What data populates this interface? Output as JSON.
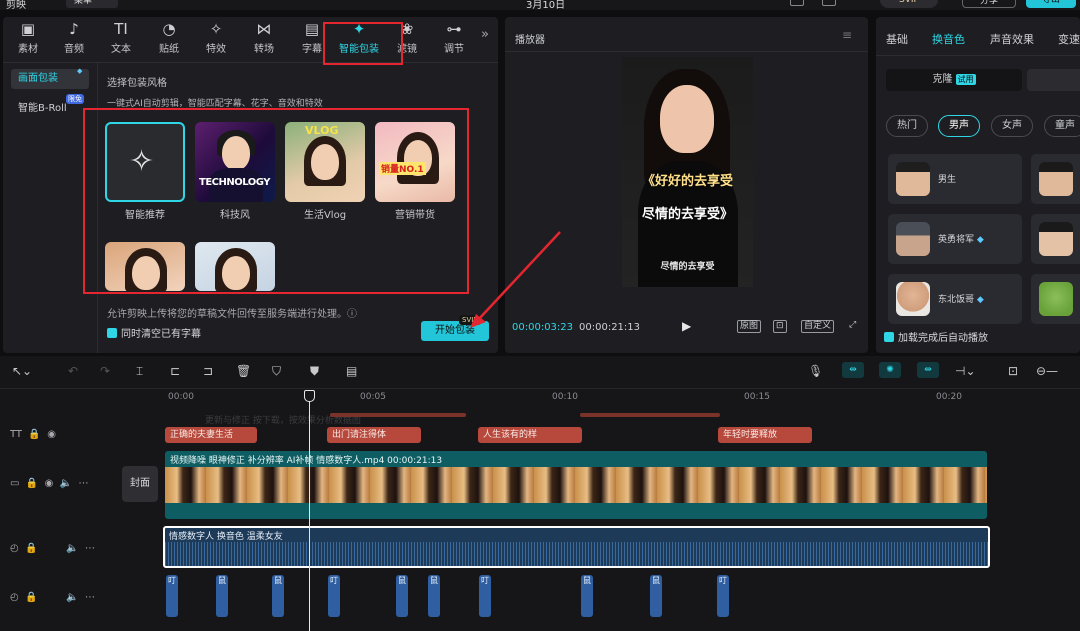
{
  "topbar": {
    "app_name": "剪映",
    "menu_label": "菜单",
    "date": "3月10日",
    "svip_label": "SVIP",
    "share_label": "分享",
    "export_label": "导出"
  },
  "toolbar": {
    "tools": [
      {
        "icon": "media-icon",
        "glyph": "▣",
        "label": "素材"
      },
      {
        "icon": "audio-icon",
        "glyph": "♪",
        "label": "音频"
      },
      {
        "icon": "text-icon",
        "glyph": "TI",
        "label": "文本"
      },
      {
        "icon": "sticker-icon",
        "glyph": "◔",
        "label": "贴纸"
      },
      {
        "icon": "effects-icon",
        "glyph": "✧",
        "label": "特效"
      },
      {
        "icon": "transition-icon",
        "glyph": "⋈",
        "label": "转场"
      },
      {
        "icon": "caption-icon",
        "glyph": "▤",
        "label": "字幕"
      },
      {
        "icon": "smart-pack-icon",
        "glyph": "✦",
        "label": "智能包装"
      },
      {
        "icon": "filter-icon",
        "glyph": "❀",
        "label": "滤镜"
      },
      {
        "icon": "adjust-icon",
        "glyph": "⊶",
        "label": "调节"
      }
    ],
    "more_glyph": "»"
  },
  "left_panel": {
    "side_items": [
      {
        "label": "画面包装",
        "badge": "◆"
      },
      {
        "label": "智能B-Roll",
        "badge": "限免"
      }
    ],
    "style_title": "选择包装风格",
    "style_desc": "一键式AI自动剪辑，智能匹配字幕、花字、音效和特效",
    "cards": [
      {
        "label": "智能推荐"
      },
      {
        "label": "科技风",
        "overlay": "TECHNOLOGY"
      },
      {
        "label": "生活Vlog",
        "overlay": "VLOG"
      },
      {
        "label": "营销带货",
        "overlay": "销量NO.1"
      },
      {
        "label": ""
      },
      {
        "label": ""
      }
    ],
    "upload_note": "允许剪映上传将您的草稿文件回传至服务端进行处理。ⓘ",
    "clear_subtitles": "同时清空已有字幕",
    "start_button": "开始包装",
    "svip_tag": "SVIP"
  },
  "player": {
    "title": "播放器",
    "captions": [
      "《好好的去享受",
      "尽情的去享受》",
      "尽情的去享受"
    ],
    "current_time": "00:00:03:23",
    "total_time": "00:00:21:13",
    "controls": [
      "原图",
      "⊡",
      "自定义",
      "⤢"
    ]
  },
  "right_panel": {
    "tabs": [
      "基础",
      "换音色",
      "声音效果",
      "变速"
    ],
    "clone_label": "克隆",
    "trial_tag": "试用",
    "chips": [
      "热门",
      "男声",
      "女声",
      "童声"
    ],
    "voices": [
      {
        "name": "男生",
        "diamond": ""
      },
      {
        "name": "英勇将军",
        "diamond": "◆"
      },
      {
        "name": "东北饭哥",
        "diamond": "◆"
      }
    ],
    "auto_play": "加载完成后自动播放"
  },
  "timeline": {
    "ticks": [
      "00:00",
      "00:05",
      "00:10",
      "00:15",
      "00:20"
    ],
    "text_clips": [
      "正确的夫妻生活",
      "出门请注得体",
      "人生该有的样",
      "年轻时要释放"
    ],
    "video_label": "视频降噪   眼神修正   补分辨率   AI补帧   情感数字人.mp4   00:00:21:13",
    "cover_label": "封面",
    "audio_label": "情感数字人   换音色 温柔女友",
    "sfx_labels": [
      "叮",
      "鼠",
      "鼠",
      "叮",
      "鼠",
      "鼠",
      "叮",
      "鼠",
      "鼠",
      "叮"
    ],
    "ghost_text": "更新与修正 按下载，按效果分析数据图"
  }
}
